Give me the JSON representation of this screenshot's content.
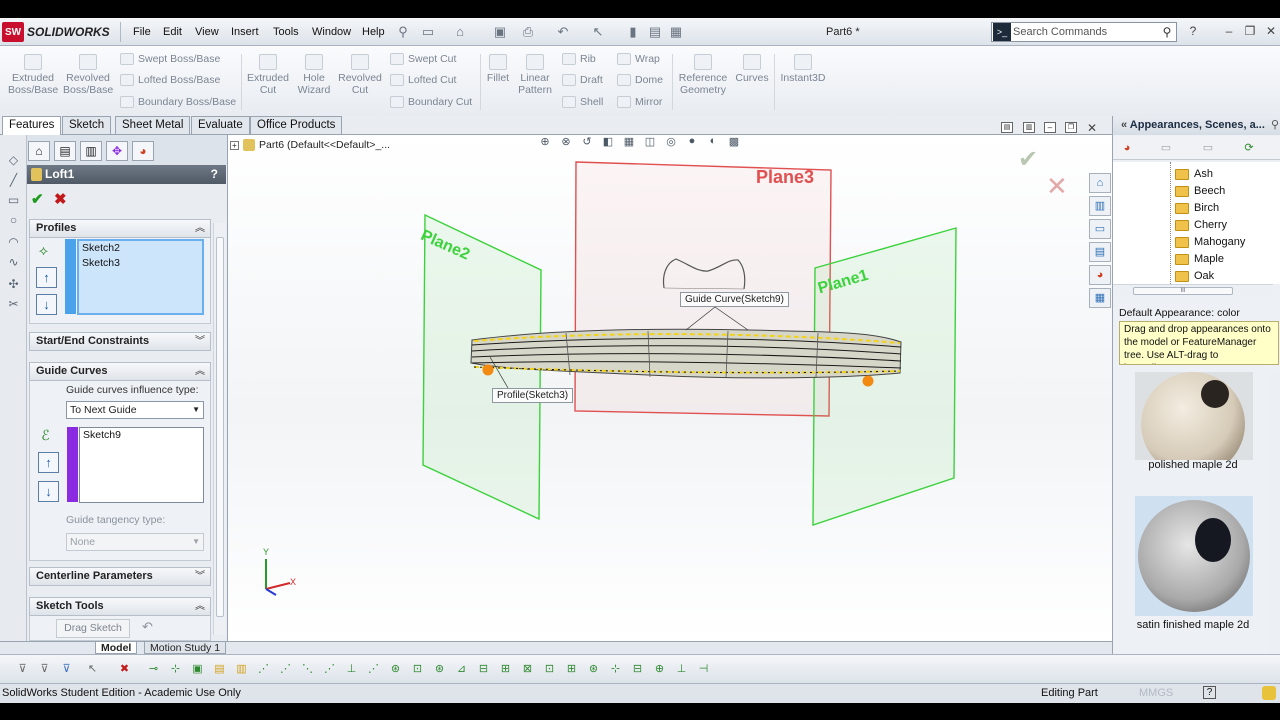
{
  "app": {
    "logo_mark": "SW",
    "logo_text": "SOLIDWORKS",
    "doc_title": "Part6 *"
  },
  "menu": [
    "File",
    "Edit",
    "View",
    "Insert",
    "Tools",
    "Window",
    "Help"
  ],
  "search": {
    "placeholder": "Search Commands"
  },
  "ribbon": {
    "extruded_boss": [
      "Extruded",
      "Boss/Base"
    ],
    "revolved_boss": [
      "Revolved",
      "Boss/Base"
    ],
    "swept_boss": "Swept Boss/Base",
    "lofted_boss": "Lofted Boss/Base",
    "boundary_boss": "Boundary Boss/Base",
    "extruded_cut": [
      "Extruded",
      "Cut"
    ],
    "hole_wizard": [
      "Hole",
      "Wizard"
    ],
    "revolved_cut": [
      "Revolved",
      "Cut"
    ],
    "swept_cut": "Swept Cut",
    "lofted_cut": "Lofted Cut",
    "boundary_cut": "Boundary Cut",
    "fillet": "Fillet",
    "linear_pattern": [
      "Linear",
      "Pattern"
    ],
    "rib": "Rib",
    "draft": "Draft",
    "shell": "Shell",
    "wrap": "Wrap",
    "dome": "Dome",
    "mirror": "Mirror",
    "ref_geometry": [
      "Reference",
      "Geometry"
    ],
    "curves": "Curves",
    "instant3d": "Instant3D"
  },
  "tabs": [
    "Features",
    "Sketch",
    "Sheet Metal",
    "Evaluate",
    "Office Products"
  ],
  "pm": {
    "title": "Loft1",
    "help": "?",
    "profiles": {
      "title": "Profiles",
      "items": [
        "Sketch2",
        "Sketch3"
      ]
    },
    "start_end": {
      "title": "Start/End Constraints"
    },
    "guide": {
      "title": "Guide Curves",
      "influence_label": "Guide curves influence type:",
      "influence_value": "To Next Guide",
      "items": [
        "Sketch9"
      ],
      "tangency_label": "Guide tangency type:",
      "tangency_value": "None"
    },
    "centerline": {
      "title": "Centerline Parameters"
    },
    "sketch_tools": {
      "title": "Sketch Tools",
      "drag_sketch": "Drag Sketch"
    }
  },
  "graphics": {
    "tree_root": "Part6  (Default<<Default>_...",
    "planes": [
      "Plane3",
      "Plane2",
      "Plane1"
    ],
    "callouts": {
      "guide": "Guide Curve(Sketch9)",
      "profile": "Profile(Sketch3)"
    },
    "triad": {
      "y": "Y",
      "x": "X"
    }
  },
  "task_pane": {
    "title": "Appearances, Scenes, a...",
    "woods": [
      "Ash",
      "Beech",
      "Birch",
      "Cherry",
      "Mahogany",
      "Maple",
      "Oak"
    ],
    "default_appearance": "Default Appearance: color",
    "tip": "Drag and drop appearances onto the model or FeatureManager tree.  Use ALT-drag to immediate...",
    "thumbs": [
      "polished maple 2d",
      "satin finished maple 2d"
    ]
  },
  "model_tabs": [
    "Model",
    "Motion Study 1"
  ],
  "status": {
    "left": "SolidWorks Student Edition - Academic Use Only",
    "editing": "Editing Part",
    "units": "MMGS",
    "help": "?"
  },
  "colors": {
    "plane_green": "#3cd23c",
    "plane_red": "#e05050",
    "accent_blue": "#1f5fb1"
  }
}
